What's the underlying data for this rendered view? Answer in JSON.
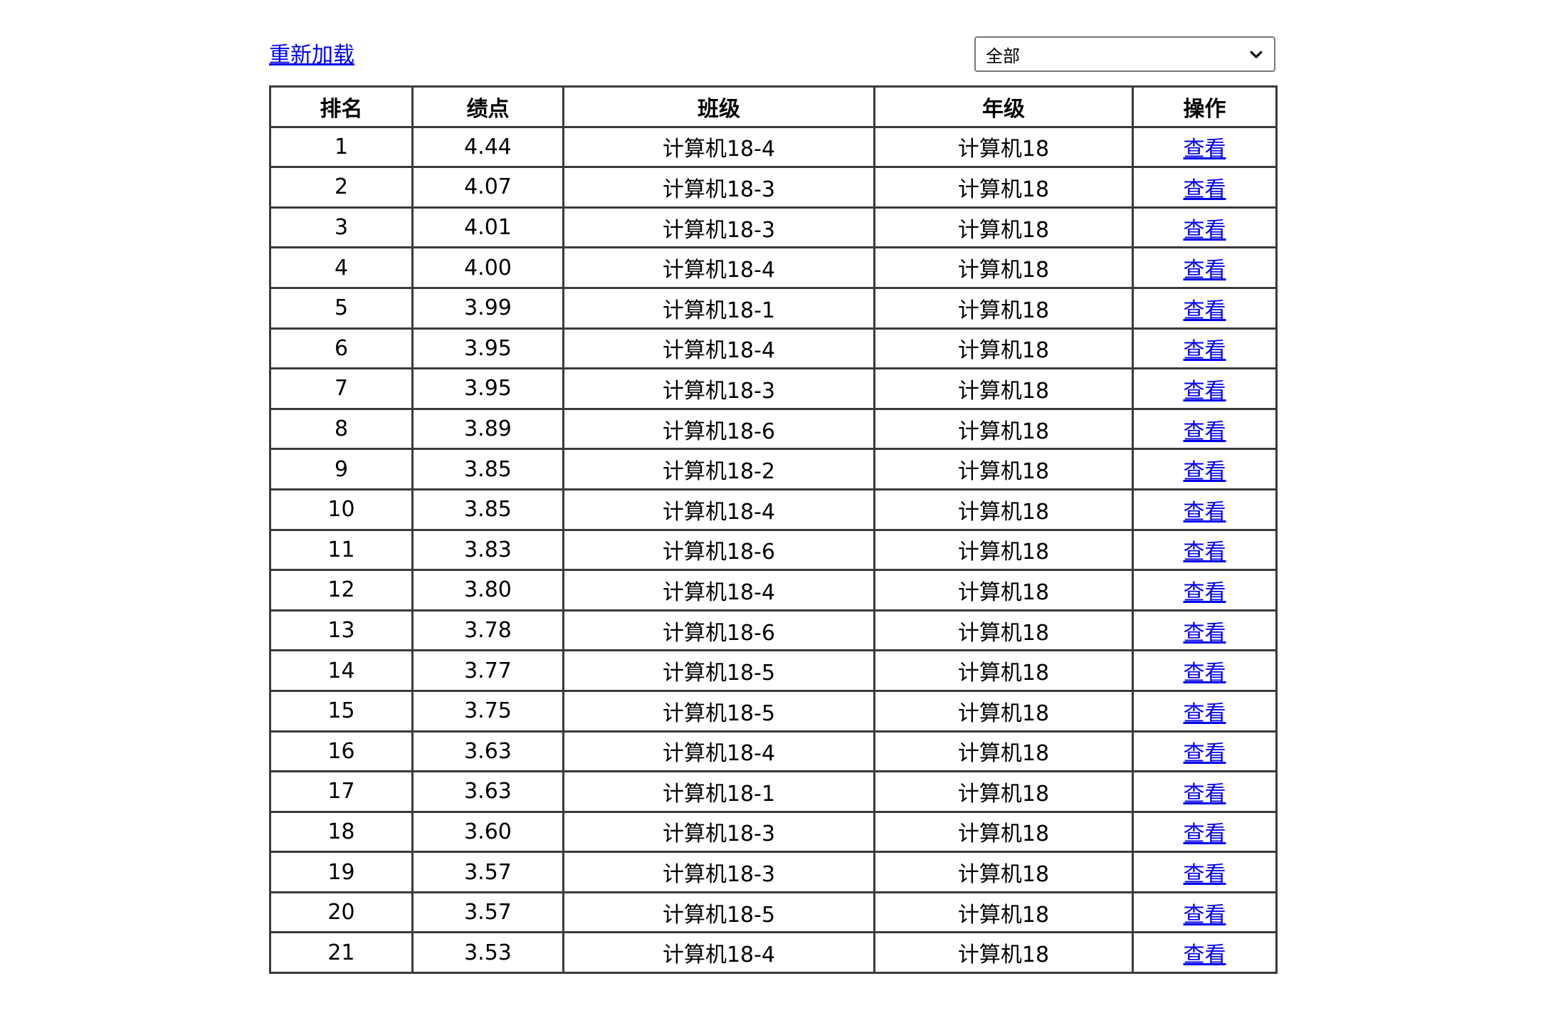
{
  "toolbar": {
    "reload_label": "重新加载",
    "filter_selected": "全部"
  },
  "table": {
    "headers": [
      "排名",
      "绩点",
      "班级",
      "年级",
      "操作"
    ],
    "rows": [
      {
        "rank": "1",
        "gpa": "4.44",
        "class": "计算机18-4",
        "grade": "计算机18",
        "action": "查看"
      },
      {
        "rank": "2",
        "gpa": "4.07",
        "class": "计算机18-3",
        "grade": "计算机18",
        "action": "查看"
      },
      {
        "rank": "3",
        "gpa": "4.01",
        "class": "计算机18-3",
        "grade": "计算机18",
        "action": "查看"
      },
      {
        "rank": "4",
        "gpa": "4.00",
        "class": "计算机18-4",
        "grade": "计算机18",
        "action": "查看"
      },
      {
        "rank": "5",
        "gpa": "3.99",
        "class": "计算机18-1",
        "grade": "计算机18",
        "action": "查看"
      },
      {
        "rank": "6",
        "gpa": "3.95",
        "class": "计算机18-4",
        "grade": "计算机18",
        "action": "查看"
      },
      {
        "rank": "7",
        "gpa": "3.95",
        "class": "计算机18-3",
        "grade": "计算机18",
        "action": "查看"
      },
      {
        "rank": "8",
        "gpa": "3.89",
        "class": "计算机18-6",
        "grade": "计算机18",
        "action": "查看"
      },
      {
        "rank": "9",
        "gpa": "3.85",
        "class": "计算机18-2",
        "grade": "计算机18",
        "action": "查看"
      },
      {
        "rank": "10",
        "gpa": "3.85",
        "class": "计算机18-4",
        "grade": "计算机18",
        "action": "查看"
      },
      {
        "rank": "11",
        "gpa": "3.83",
        "class": "计算机18-6",
        "grade": "计算机18",
        "action": "查看"
      },
      {
        "rank": "12",
        "gpa": "3.80",
        "class": "计算机18-4",
        "grade": "计算机18",
        "action": "查看"
      },
      {
        "rank": "13",
        "gpa": "3.78",
        "class": "计算机18-6",
        "grade": "计算机18",
        "action": "查看"
      },
      {
        "rank": "14",
        "gpa": "3.77",
        "class": "计算机18-5",
        "grade": "计算机18",
        "action": "查看"
      },
      {
        "rank": "15",
        "gpa": "3.75",
        "class": "计算机18-5",
        "grade": "计算机18",
        "action": "查看"
      },
      {
        "rank": "16",
        "gpa": "3.63",
        "class": "计算机18-4",
        "grade": "计算机18",
        "action": "查看"
      },
      {
        "rank": "17",
        "gpa": "3.63",
        "class": "计算机18-1",
        "grade": "计算机18",
        "action": "查看"
      },
      {
        "rank": "18",
        "gpa": "3.60",
        "class": "计算机18-3",
        "grade": "计算机18",
        "action": "查看"
      },
      {
        "rank": "19",
        "gpa": "3.57",
        "class": "计算机18-3",
        "grade": "计算机18",
        "action": "查看"
      },
      {
        "rank": "20",
        "gpa": "3.57",
        "class": "计算机18-5",
        "grade": "计算机18",
        "action": "查看"
      },
      {
        "rank": "21",
        "gpa": "3.53",
        "class": "计算机18-4",
        "grade": "计算机18",
        "action": "查看"
      }
    ]
  }
}
